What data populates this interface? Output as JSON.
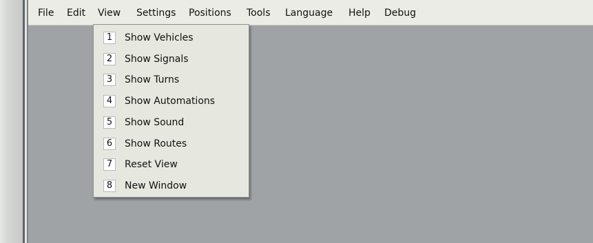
{
  "menubar": {
    "items": [
      "File",
      "Edit",
      "View",
      "Settings",
      "Positions",
      "Tools",
      "Language",
      "Help",
      "Debug"
    ]
  },
  "view_menu": {
    "items": [
      {
        "key": "1",
        "label": "Show Vehicles"
      },
      {
        "key": "2",
        "label": "Show Signals"
      },
      {
        "key": "3",
        "label": "Show Turns"
      },
      {
        "key": "4",
        "label": "Show Automations"
      },
      {
        "key": "5",
        "label": "Show Sound"
      },
      {
        "key": "6",
        "label": "Show Routes"
      },
      {
        "key": "7",
        "label": "Reset View"
      },
      {
        "key": "8",
        "label": "New Window"
      }
    ]
  },
  "colors": {
    "menubar_bg": "#ebece5",
    "menu_bg": "#e6e7df",
    "workspace_bg": "#9fa3a6"
  }
}
